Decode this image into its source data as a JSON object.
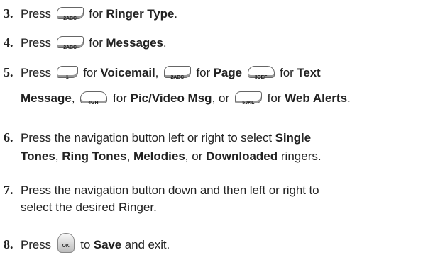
{
  "steps": [
    {
      "number": "3.",
      "pre": "Press",
      "key": "2ABC",
      "mid": "for",
      "bold": "Ringer Type",
      "post": "."
    },
    {
      "number": "4.",
      "pre": "Press",
      "key": "2ABC",
      "mid": "for",
      "bold": "Messages",
      "post": "."
    }
  ],
  "step5": {
    "number": "5.",
    "line1": {
      "pre": "Press",
      "key1": "1",
      "t1": "for",
      "b1": "Voicemail",
      "c1": ",",
      "key2": "2ABC",
      "t2": "for",
      "b2": "Page",
      "key3": "3DEF",
      "t3": "for",
      "b3": "Text"
    },
    "line2": {
      "b1": "Message",
      "c1": ",",
      "key1": "4GHI",
      "t1": "for",
      "b2": "Pic/Video Msg",
      "t2": ", or",
      "key2": "5JKL",
      "t3": "for",
      "b3": "Web Alerts",
      "end": "."
    }
  },
  "step6": {
    "number": "6.",
    "line1": {
      "pre": "Press the navigation button left or right to select",
      "b1": "Single"
    },
    "line2": {
      "b1": "Tones",
      "c1": ",",
      "b2": "Ring Tones",
      "c2": ",",
      "b3": "Melodies",
      "c3": ", or",
      "b4": "Downloaded",
      "end": "ringers."
    }
  },
  "step7": {
    "number": "7.",
    "line1": "Press the navigation button down and then left or right to",
    "line2": "select the desired Ringer."
  },
  "step8": {
    "number": "8.",
    "pre": "Press",
    "key": "OK",
    "mid": "to",
    "bold": "Save",
    "post": "and exit."
  }
}
